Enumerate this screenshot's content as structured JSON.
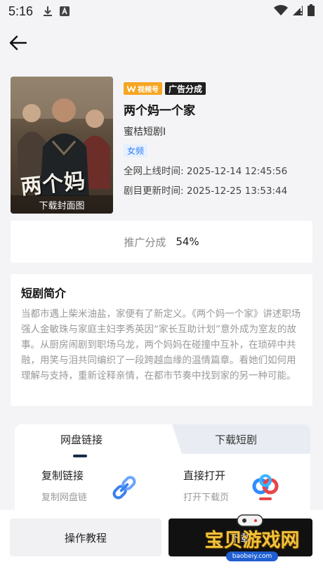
{
  "status_bar": {
    "time": "5:16",
    "left_icons": [
      "download-icon",
      "font-a-icon"
    ],
    "right_icons": [
      "wifi-icon",
      "cell-signal-icon",
      "battery-icon"
    ]
  },
  "drama": {
    "cover_art_title": "两个妈",
    "download_cover_label": "下载封面图",
    "badge_platform": "视频号",
    "badge_ad": "广告分成",
    "title": "两个妈一个家",
    "producer": "蜜桔短剧I",
    "genre_tag": "女频",
    "online_time_label": "全网上线时间:",
    "online_time": "2025-12-14 12:45:56",
    "update_time_label": "剧目更新时间:",
    "update_time": "2025-12-25 13:53:44"
  },
  "promo": {
    "label": "推广分成",
    "value": "54%"
  },
  "intro": {
    "heading": "短剧简介",
    "text": "当都市遇上柴米油盐，家便有了新定义。《两个妈一个家》讲述职场强人金敏珠与家庭主妇李秀英因“家长互助计划”意外成为室友的故事。从厨房闹剧到职场乌龙，两个妈妈在碰撞中互补，在琐碎中共融，用笑与泪共同编织了一段跨越血缘的温情篇章。看她们如何用理解与支持，重新诠释亲情，在都市节奏中找到家的另一种可能。"
  },
  "tabs": {
    "items": [
      {
        "label": "网盘链接",
        "active": true
      },
      {
        "label": "下载短剧",
        "active": false
      }
    ]
  },
  "actions": {
    "copy": {
      "title": "复制链接",
      "subtitle": "复制网盘链"
    },
    "open": {
      "title": "直接打开",
      "subtitle": "打开下载页"
    }
  },
  "bottom": {
    "tutorial_label": "操作教程",
    "download_label": "下载"
  },
  "watermark": {
    "text": "宝贝游戏网",
    "url": "baobeiy.com"
  },
  "colors": {
    "accent_blue": "#2f7cf6",
    "badge_orange": "#f6a623",
    "dark": "#111111"
  }
}
